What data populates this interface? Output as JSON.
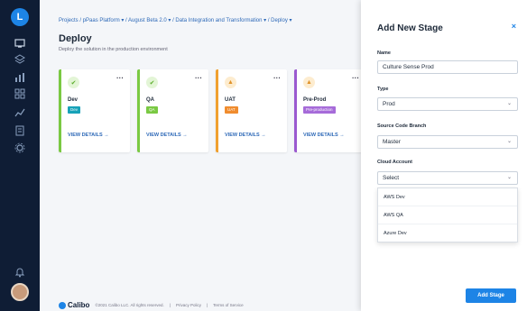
{
  "nav": {
    "logo_letter": "L",
    "icons": [
      "monitor-icon",
      "layers-icon",
      "chart-icon",
      "grid-icon",
      "trend-icon",
      "list-icon",
      "settings-icon"
    ],
    "bottom_icons": [
      "bell-icon"
    ]
  },
  "header": {
    "breadcrumb": "Projects / pPaas Platform ▾ / August Beta 2.0 ▾ / Data Integration and Transformation ▾ / Deploy ▾",
    "title": "Deploy",
    "subtitle": "Deploy the solution in the production environment"
  },
  "stages": [
    {
      "name": "Dev",
      "badge": "Dev",
      "color": "#7ac943",
      "badge_color": "#17a2b8",
      "status": "success",
      "details": "VIEW DETAILS →"
    },
    {
      "name": "QA",
      "badge": "QA",
      "color": "#7ac943",
      "badge_color": "#7ac943",
      "status": "success",
      "details": "VIEW DETAILS →"
    },
    {
      "name": "UAT",
      "badge": "UAT",
      "color": "#f0a030",
      "badge_color": "#f08c2e",
      "status": "warning",
      "details": "VIEW DETAILS →"
    },
    {
      "name": "Pre-Prod",
      "badge": "Pre-production",
      "color": "#9b59d0",
      "badge_color": "#a66bd9",
      "status": "warning",
      "details": "VIEW DETAILS →"
    }
  ],
  "footer": {
    "brand": "Calibo",
    "copyright": "©2021 Calibo LLC. All rights reserved.",
    "privacy": "Privacy Policy",
    "terms": "Terms of Service"
  },
  "panel": {
    "title": "Add New Stage",
    "close": "×",
    "name_label": "Name",
    "name_value": "Culture Sense Prod",
    "type_label": "Type",
    "type_value": "Prod",
    "branch_label": "Source Code Branch",
    "branch_value": "Master",
    "cloud_label": "Cloud Account",
    "cloud_placeholder": "Select",
    "cloud_options": [
      "AWS Dev",
      "AWS QA",
      "Azure Dev"
    ],
    "submit": "Add Stage"
  }
}
